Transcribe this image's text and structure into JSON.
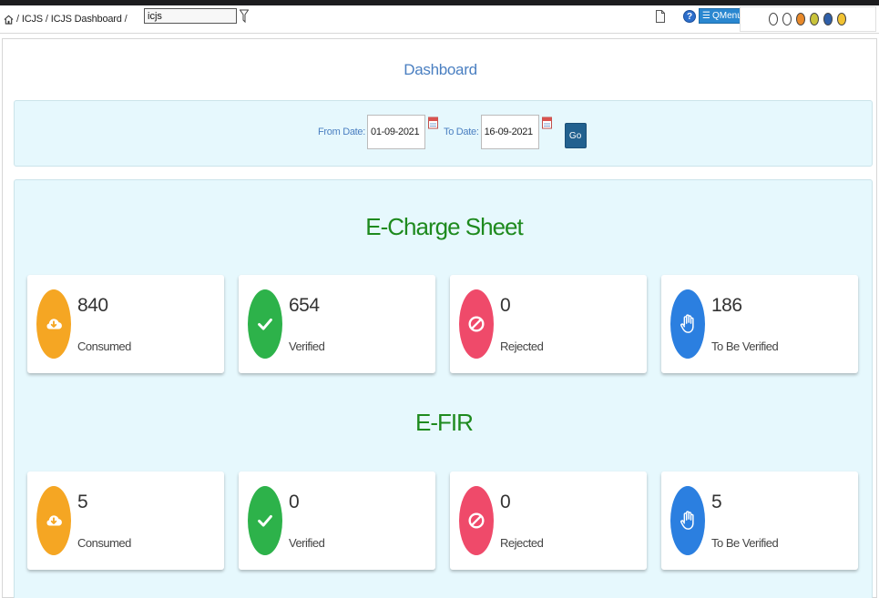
{
  "breadcrumb": {
    "items": [
      "ICJS",
      "ICJS Dashboard"
    ],
    "separator": "/"
  },
  "search": {
    "value": "icjs",
    "placeholder": ""
  },
  "toolbar": {
    "help_label": "?",
    "qmenu_label": "QMenu"
  },
  "theme_swatches": [
    "#ffffff",
    "#ffffff",
    "#e8892a",
    "#c9c33a",
    "#2f5fa8",
    "#f1c232"
  ],
  "page": {
    "title": "Dashboard"
  },
  "date_filter": {
    "from_label": "From Date:",
    "from_value": "01-09-2021",
    "to_label": "To Date:",
    "to_value": "16-09-2021",
    "go_label": "Go"
  },
  "sections": [
    {
      "title": "E-Charge Sheet",
      "cards": [
        {
          "value": "840",
          "label": "Consumed",
          "color": "#f5a623",
          "icon": "cloud-download-icon"
        },
        {
          "value": "654",
          "label": "Verified",
          "color": "#2db24a",
          "icon": "check-icon"
        },
        {
          "value": "0",
          "label": "Rejected",
          "color": "#ef4a6a",
          "icon": "ban-icon"
        },
        {
          "value": "186",
          "label": "To Be Verified",
          "color": "#2b7fe0",
          "icon": "hand-icon"
        }
      ]
    },
    {
      "title": "E-FIR",
      "cards": [
        {
          "value": "5",
          "label": "Consumed",
          "color": "#f5a623",
          "icon": "cloud-download-icon"
        },
        {
          "value": "0",
          "label": "Verified",
          "color": "#2db24a",
          "icon": "check-icon"
        },
        {
          "value": "0",
          "label": "Rejected",
          "color": "#ef4a6a",
          "icon": "ban-icon"
        },
        {
          "value": "5",
          "label": "To Be Verified",
          "color": "#2b7fe0",
          "icon": "hand-icon"
        }
      ]
    }
  ]
}
